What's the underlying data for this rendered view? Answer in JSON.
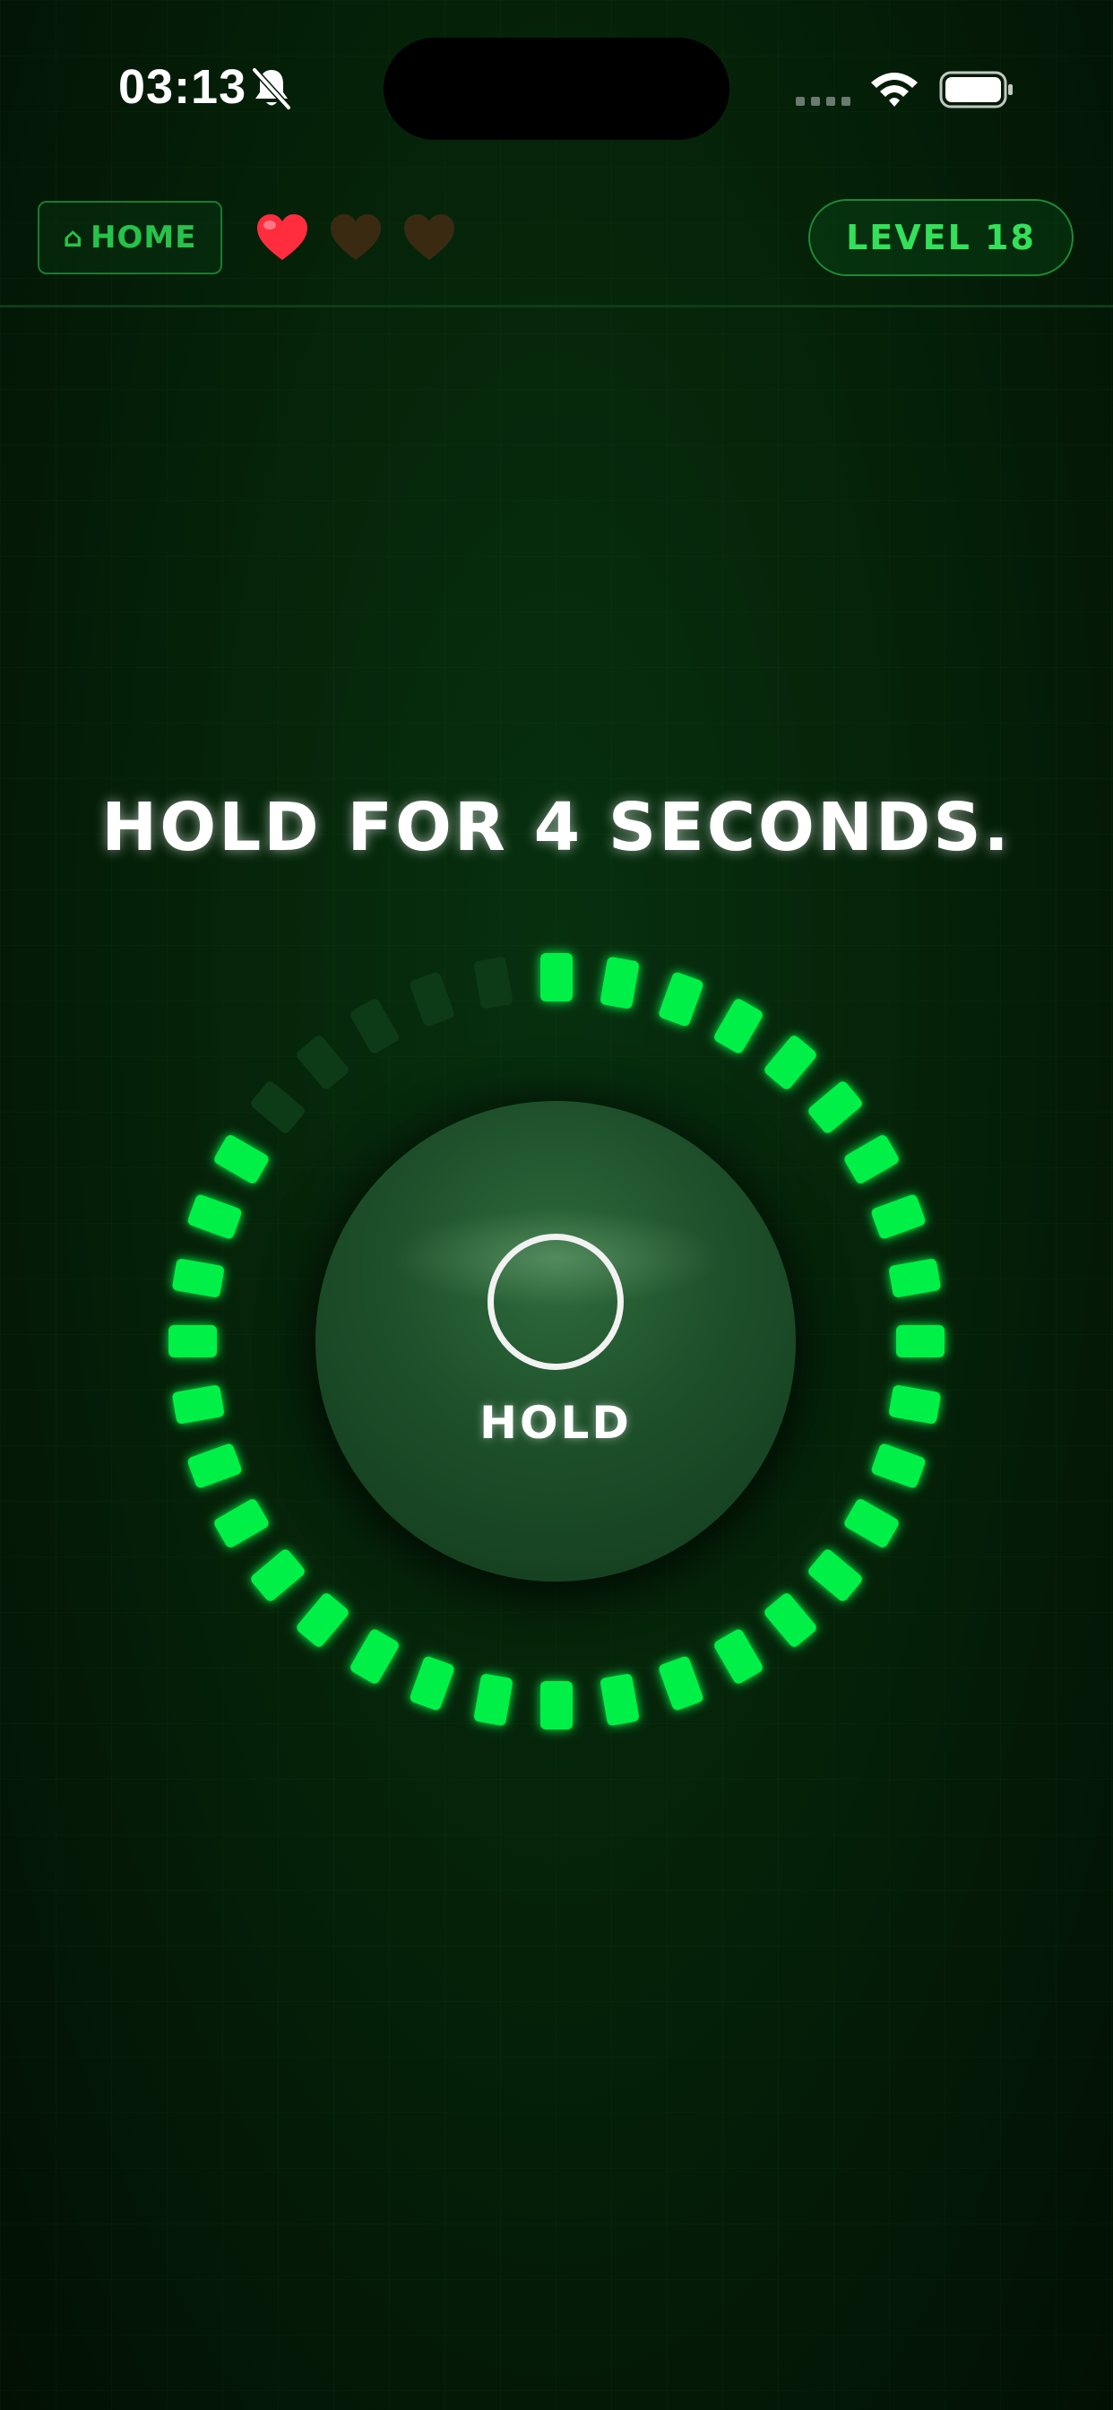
{
  "status_bar": {
    "time": "03:13",
    "icons": [
      "bell-slash-icon",
      "signal-icon",
      "wifi-icon",
      "battery-icon"
    ]
  },
  "header": {
    "home_icon": "home-icon",
    "home_icon_glyph": "⌂",
    "home_label": "HOME",
    "lives": {
      "total": 3,
      "remaining": 1
    },
    "level_label": "LEVEL 18"
  },
  "game": {
    "instruction": "HOLD FOR 4 SECONDS.",
    "hold_label": "HOLD",
    "progress_ring": {
      "segments": 36,
      "lit_segments": 31,
      "progress_fraction": 0.861
    }
  },
  "colors": {
    "background": "#031a08",
    "accent": "#00f046",
    "segment_dim": "#0d3b18",
    "heart_full": "#ff2d3d",
    "heart_empty": "#3a2a12"
  }
}
